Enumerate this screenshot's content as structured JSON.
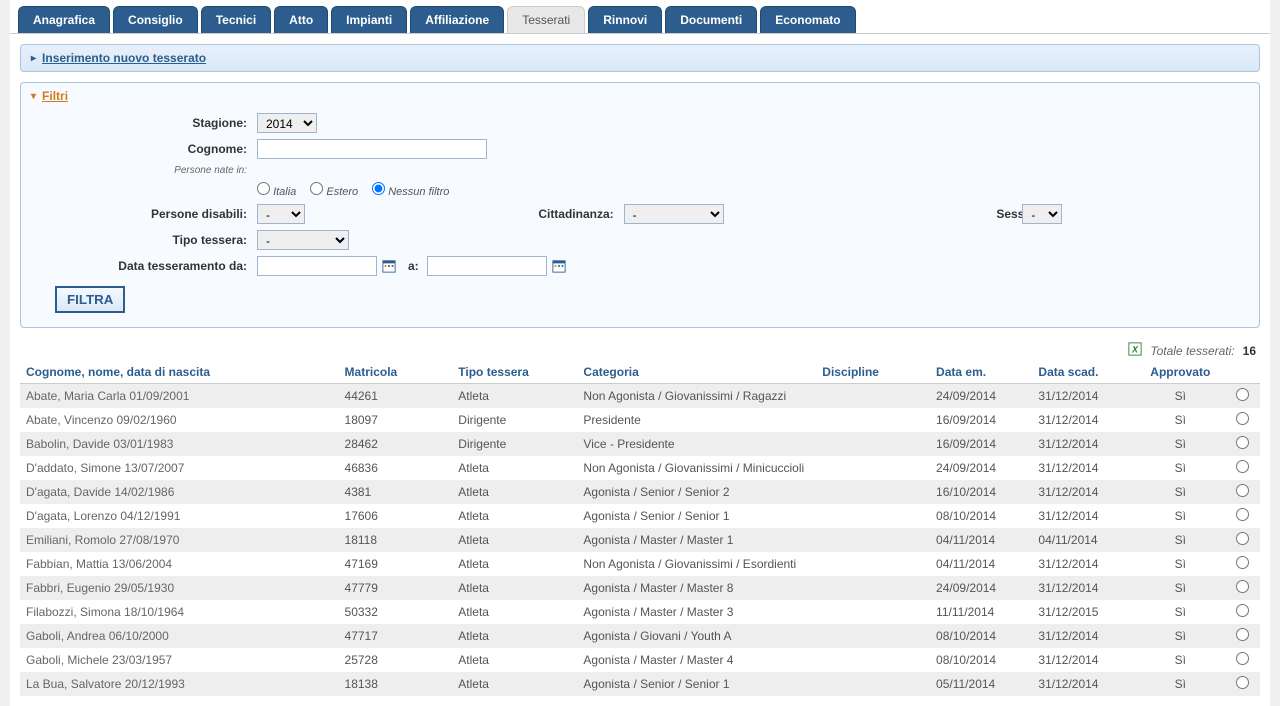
{
  "tabs": [
    {
      "label": "Anagrafica",
      "active": true
    },
    {
      "label": "Consiglio",
      "active": true
    },
    {
      "label": "Tecnici",
      "active": true
    },
    {
      "label": "Atto",
      "active": true
    },
    {
      "label": "Impianti",
      "active": true
    },
    {
      "label": "Affiliazione",
      "active": true
    },
    {
      "label": "Tesserati",
      "active": false
    },
    {
      "label": "Rinnovi",
      "active": true
    },
    {
      "label": "Documenti",
      "active": true
    },
    {
      "label": "Economato",
      "active": true
    }
  ],
  "panel_insert": "Inserimento nuovo tesserato",
  "filters": {
    "title": "Filtri",
    "labels": {
      "stagione": "Stagione:",
      "cognome": "Cognome:",
      "persone_nate": "Persone nate in:",
      "italia": "Italia",
      "estero": "Estero",
      "nessun_filtro": "Nessun filtro",
      "disabili": "Persone disabili:",
      "cittadinanza": "Cittadinanza:",
      "sesso": "Sesso:",
      "tipo_tessera": "Tipo tessera:",
      "data_da": "Data tesseramento da:",
      "a": "a:",
      "button": "FILTRA"
    },
    "values": {
      "stagione": "2014",
      "disabili": "-",
      "cittadinanza": "-",
      "sesso": "-",
      "tipo_tessera": "-"
    }
  },
  "totals": {
    "label": "Totale tesserati:",
    "count": "16"
  },
  "columns": {
    "name": "Cognome, nome, data di nascita",
    "matricola": "Matricola",
    "tipo": "Tipo tessera",
    "categoria": "Categoria",
    "discipline": "Discipline",
    "emissione": "Data em.",
    "scadenza": "Data scad.",
    "approvato": "Approvato"
  },
  "rows": [
    {
      "name": "Abate, Maria Carla 01/09/2001",
      "matricola": "44261",
      "tipo": "Atleta",
      "categoria": "Non Agonista / Giovanissimi / Ragazzi",
      "discipline": "",
      "em": "24/09/2014",
      "scad": "31/12/2014",
      "appr": "Sì"
    },
    {
      "name": "Abate, Vincenzo 09/02/1960",
      "matricola": "18097",
      "tipo": "Dirigente",
      "categoria": "Presidente",
      "discipline": "",
      "em": "16/09/2014",
      "scad": "31/12/2014",
      "appr": "Sì"
    },
    {
      "name": "Babolin, Davide 03/01/1983",
      "matricola": "28462",
      "tipo": "Dirigente",
      "categoria": "Vice - Presidente",
      "discipline": "",
      "em": "16/09/2014",
      "scad": "31/12/2014",
      "appr": "Sì"
    },
    {
      "name": "D'addato, Simone 13/07/2007",
      "matricola": "46836",
      "tipo": "Atleta",
      "categoria": "Non Agonista / Giovanissimi / Minicuccioli",
      "discipline": "",
      "em": "24/09/2014",
      "scad": "31/12/2014",
      "appr": "Sì"
    },
    {
      "name": "D'agata, Davide 14/02/1986",
      "matricola": "4381",
      "tipo": "Atleta",
      "categoria": "Agonista / Senior / Senior 2",
      "discipline": "",
      "em": "16/10/2014",
      "scad": "31/12/2014",
      "appr": "Sì"
    },
    {
      "name": "D'agata, Lorenzo 04/12/1991",
      "matricola": "17606",
      "tipo": "Atleta",
      "categoria": "Agonista / Senior / Senior 1",
      "discipline": "",
      "em": "08/10/2014",
      "scad": "31/12/2014",
      "appr": "Sì"
    },
    {
      "name": "Emiliani, Romolo 27/08/1970",
      "matricola": "18118",
      "tipo": "Atleta",
      "categoria": "Agonista / Master / Master 1",
      "discipline": "",
      "em": "04/11/2014",
      "scad": "04/11/2014",
      "appr": "Sì"
    },
    {
      "name": "Fabbian, Mattia 13/06/2004",
      "matricola": "47169",
      "tipo": "Atleta",
      "categoria": "Non Agonista / Giovanissimi / Esordienti",
      "discipline": "",
      "em": "04/11/2014",
      "scad": "31/12/2014",
      "appr": "Sì"
    },
    {
      "name": "Fabbri, Eugenio 29/05/1930",
      "matricola": "47779",
      "tipo": "Atleta",
      "categoria": "Agonista / Master / Master 8",
      "discipline": "",
      "em": "24/09/2014",
      "scad": "31/12/2014",
      "appr": "Sì"
    },
    {
      "name": "Filabozzi, Simona 18/10/1964",
      "matricola": "50332",
      "tipo": "Atleta",
      "categoria": "Agonista / Master / Master 3",
      "discipline": "",
      "em": "11/11/2014",
      "scad": "31/12/2015",
      "appr": "Sì"
    },
    {
      "name": "Gaboli, Andrea 06/10/2000",
      "matricola": "47717",
      "tipo": "Atleta",
      "categoria": "Agonista / Giovani / Youth A",
      "discipline": "",
      "em": "08/10/2014",
      "scad": "31/12/2014",
      "appr": "Sì"
    },
    {
      "name": "Gaboli, Michele 23/03/1957",
      "matricola": "25728",
      "tipo": "Atleta",
      "categoria": "Agonista / Master / Master 4",
      "discipline": "",
      "em": "08/10/2014",
      "scad": "31/12/2014",
      "appr": "Sì"
    },
    {
      "name": "La Bua, Salvatore 20/12/1993",
      "matricola": "18138",
      "tipo": "Atleta",
      "categoria": "Agonista / Senior / Senior 1",
      "discipline": "",
      "em": "05/11/2014",
      "scad": "31/12/2014",
      "appr": "Sì"
    }
  ]
}
